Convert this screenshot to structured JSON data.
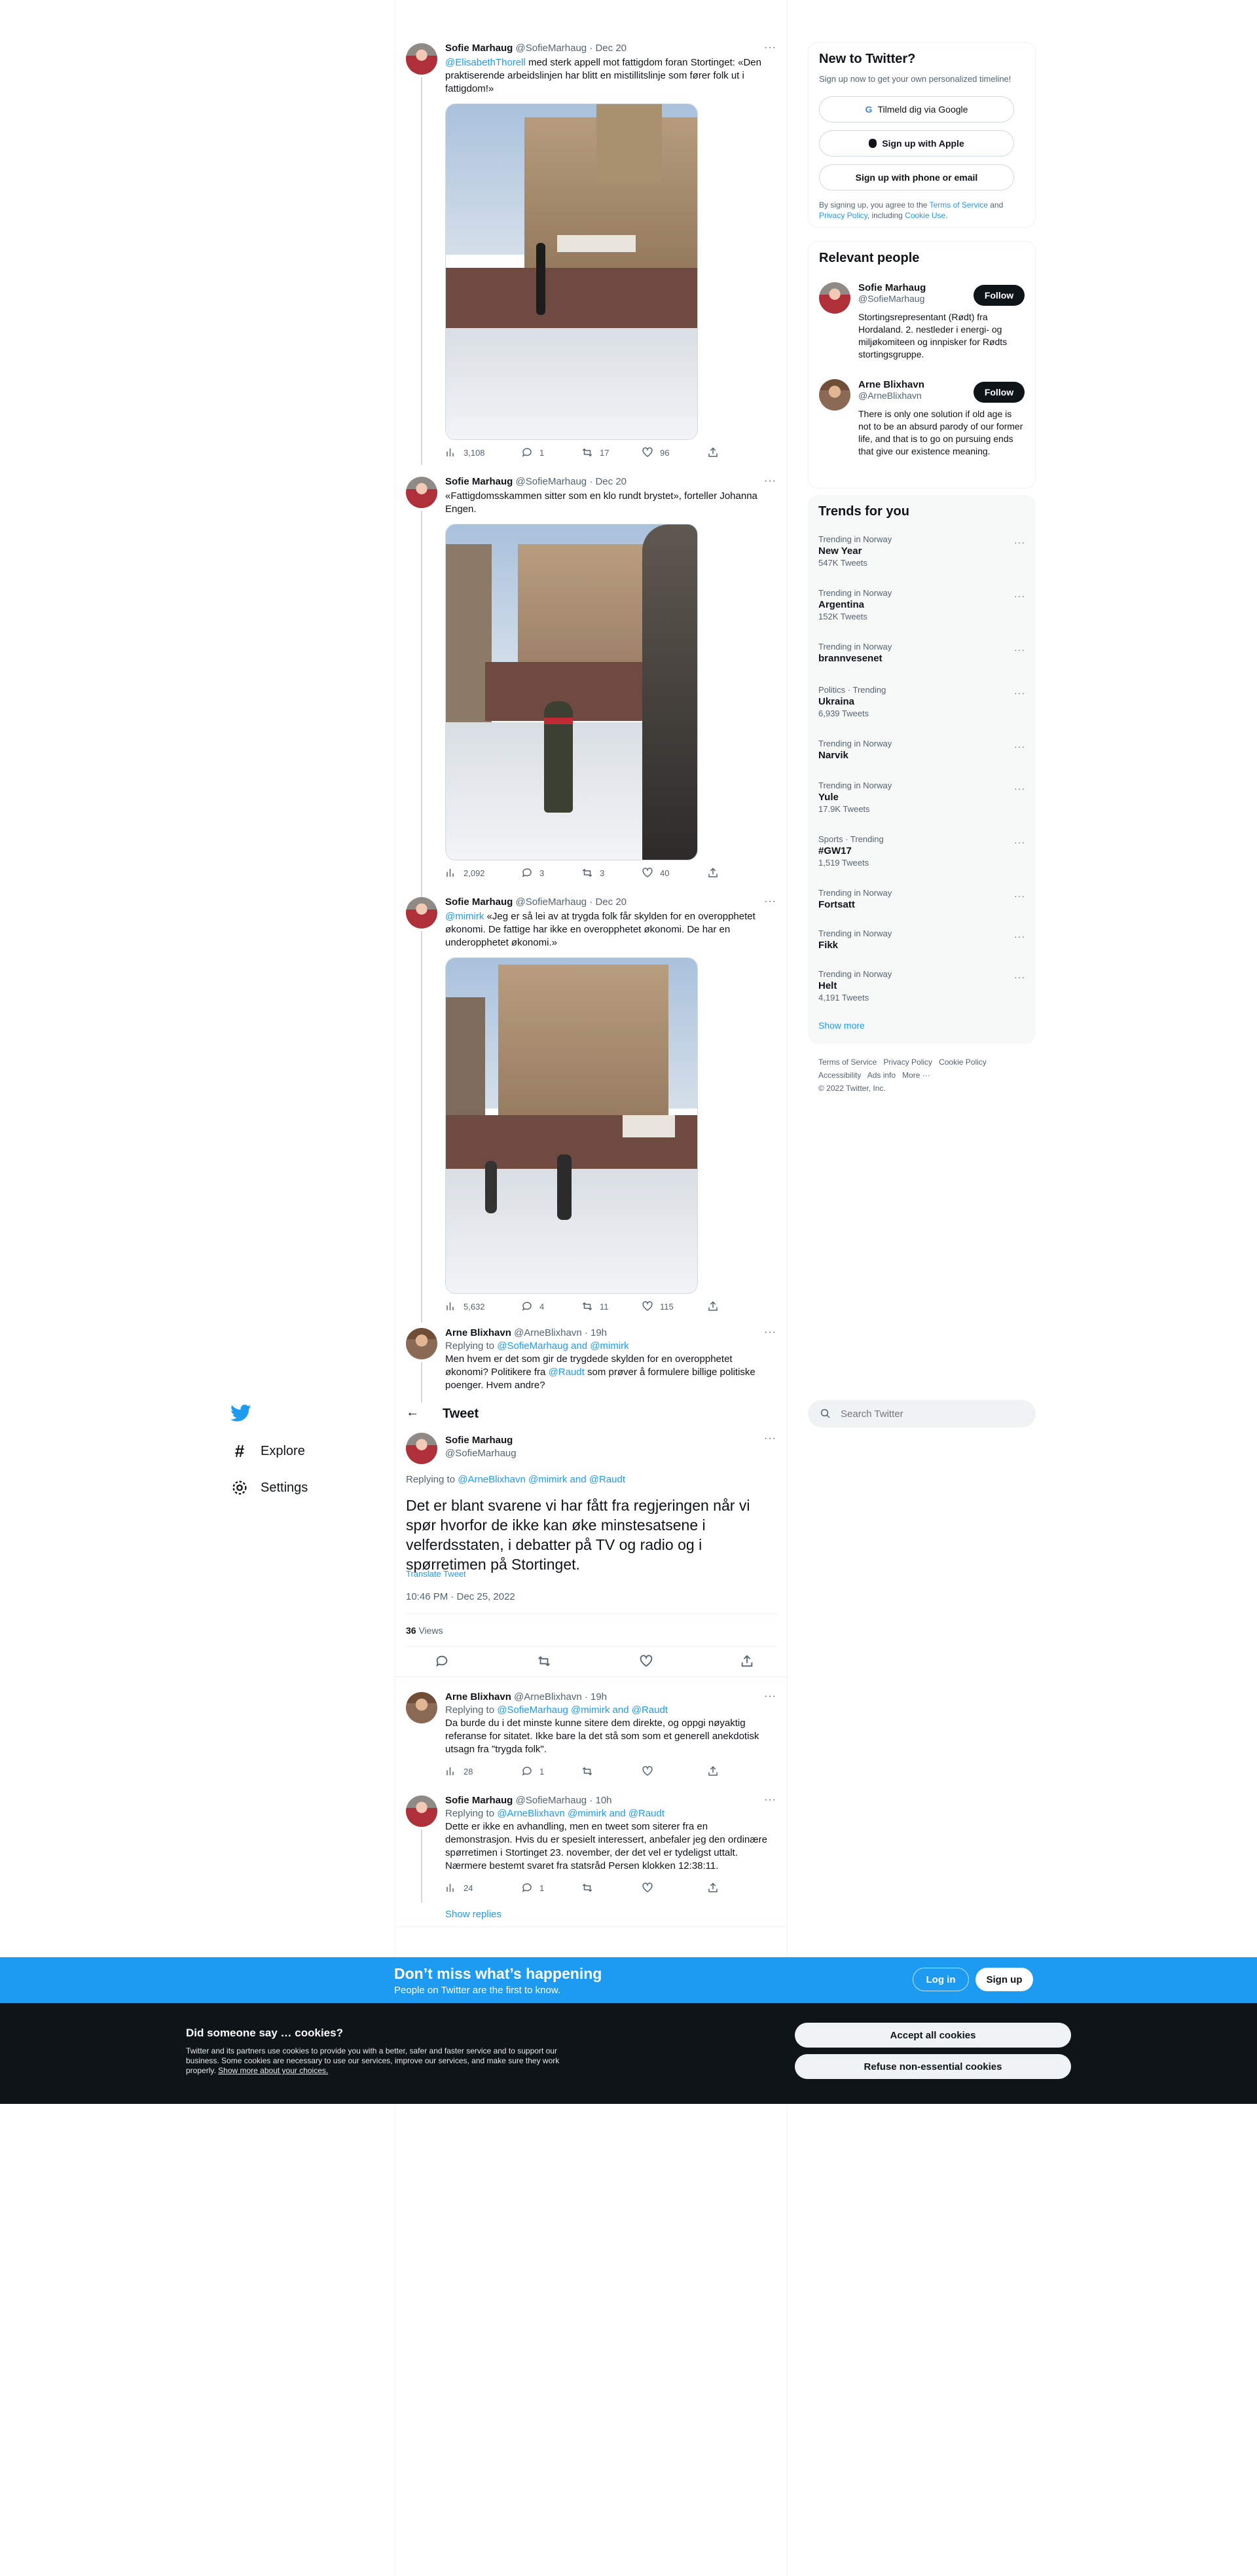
{
  "nav": {
    "explore": "Explore",
    "settings": "Settings"
  },
  "header": {
    "title": "Tweet"
  },
  "search": {
    "placeholder": "Search Twitter"
  },
  "tweets": [
    {
      "name": "Sofie Marhaug",
      "handle": "@SofieMarhaug · Dec 20",
      "mention": "@ElisabethThorell",
      "text": " med sterk appell mot fattigdom foran Stortinget: «Den praktiserende arbeidslinjen har blitt en mistillitslinje som fører folk ut i fattigdom!»",
      "views": "3,108",
      "replies": "1",
      "retweets": "17",
      "likes": "96"
    },
    {
      "name": "Sofie Marhaug",
      "handle": "@SofieMarhaug · Dec 20",
      "text": "«Fattigdomsskammen sitter som en klo rundt brystet», forteller Johanna Engen.",
      "views": "2,092",
      "replies": "3",
      "retweets": "3",
      "likes": "40"
    },
    {
      "name": "Sofie Marhaug",
      "handle": "@SofieMarhaug · Dec 20",
      "mention": "@mimirk",
      "text": " «Jeg er så lei av at trygda folk får skylden for en overopphetet økonomi. De fattige har ikke en overopphetet økonomi. De har en underopphetet økonomi.»",
      "views": "5,632",
      "replies": "4",
      "retweets": "11",
      "likes": "115"
    },
    {
      "name": "Arne Blixhavn",
      "handle": "@ArneBlixhavn · 19h",
      "replying_prefix": "Replying to ",
      "replying_to": "@SofieMarhaug and @mimirk",
      "text_a": "Men hvem er det som gir de trygdede skylden for en overopphetet økonomi? Politikere fra ",
      "text_mention": "@Raudt",
      "text_b": " som prøver å formulere billige politiske poenger. Hvem andre?"
    }
  ],
  "main_tweet": {
    "name": "Sofie Marhaug",
    "handle": "@SofieMarhaug",
    "replying_prefix": "Replying to ",
    "replying_to": "@ArneBlixhavn @mimirk and @Raudt",
    "text": "Det er blant svarene vi har fått fra regjeringen når vi spør hvorfor de ikke kan øke minstesatsene i velferdsstaten, i debatter på TV og radio og i spørretimen på Stortinget.",
    "translate": "Translate Tweet",
    "timestamp": "10:46 PM · Dec 25, 2022",
    "views_count": "36",
    "views_label": " Views"
  },
  "replies": [
    {
      "name": "Arne Blixhavn",
      "handle": "@ArneBlixhavn · 19h",
      "replying_prefix": "Replying to ",
      "replying_to": "@SofieMarhaug @mimirk and @Raudt",
      "text": "Da burde du i det minste kunne sitere dem direkte, og oppgi nøyaktig referanse for sitatet. Ikke bare la det stå som som et generell anekdotisk utsagn fra \"trygda folk\".",
      "views": "28",
      "replies": "1",
      "retweets": "",
      "likes": ""
    },
    {
      "name": "Sofie Marhaug",
      "handle": "@SofieMarhaug · 10h",
      "replying_prefix": "Replying to ",
      "replying_to": "@ArneBlixhavn @mimirk and @Raudt",
      "text": "Dette er ikke en avhandling, men en tweet som siterer fra en demonstrasjon. Hvis du er spesielt interessert, anbefaler jeg den ordinære spørretimen i Stortinget 23. november, der det vel er tydeligst uttalt. Nærmere bestemt svaret fra statsråd Persen klokken 12:38:11.",
      "views": "24",
      "replies": "1",
      "retweets": "",
      "likes": ""
    }
  ],
  "show_replies": "Show replies",
  "signup": {
    "title": "New to Twitter?",
    "subtitle": "Sign up now to get your own personalized timeline!",
    "google": "Tilmeld dig via Google",
    "apple": "Sign up with Apple",
    "phone": "Sign up with phone or email",
    "terms_a": "By signing up, you agree to the ",
    "terms_link": "Terms of Service",
    "terms_b": " and ",
    "privacy_link": "Privacy Policy",
    "terms_c": ", including ",
    "cookie_link": "Cookie Use",
    "terms_d": "."
  },
  "relevant": {
    "title": "Relevant people",
    "follow": "Follow",
    "people": [
      {
        "name": "Sofie Marhaug",
        "handle": "@SofieMarhaug",
        "bio": "Stortingsrepresentant (Rødt) fra Hordaland. 2. nestleder i energi- og miljøkomiteen og innpisker for Rødts stortingsgruppe."
      },
      {
        "name": "Arne Blixhavn",
        "handle": "@ArneBlixhavn",
        "bio": "There is only one solution if old age is not to be an absurd parody of our former life, and that is to go on pursuing ends that give our existence meaning."
      }
    ]
  },
  "trends": {
    "title": "Trends for you",
    "items": [
      {
        "context": "Trending in Norway",
        "name": "New Year",
        "count": "547K Tweets"
      },
      {
        "context": "Trending in Norway",
        "name": "Argentina",
        "count": "152K Tweets"
      },
      {
        "context": "Trending in Norway",
        "name": "brannvesenet",
        "count": ""
      },
      {
        "context": "Politics · Trending",
        "name": "Ukraina",
        "count": "6,939 Tweets"
      },
      {
        "context": "Trending in Norway",
        "name": "Narvik",
        "count": ""
      },
      {
        "context": "Trending in Norway",
        "name": "Yule",
        "count": "17.9K Tweets"
      },
      {
        "context": "Sports · Trending",
        "name": "#GW17",
        "count": "1,519 Tweets"
      },
      {
        "context": "Trending in Norway",
        "name": "Fortsatt",
        "count": ""
      },
      {
        "context": "Trending in Norway",
        "name": "Fikk",
        "count": ""
      },
      {
        "context": "Trending in Norway",
        "name": "Helt",
        "count": "4,191 Tweets"
      }
    ],
    "show_more": "Show more"
  },
  "footer": {
    "terms": "Terms of Service",
    "privacy": "Privacy Policy",
    "cookie": "Cookie Policy",
    "accessibility": "Accessibility",
    "ads": "Ads info",
    "more": "More ···",
    "copyright": "© 2022 Twitter, Inc."
  },
  "banner": {
    "title": "Don’t miss what’s happening",
    "subtitle": "People on Twitter are the first to know.",
    "login": "Log in",
    "signup": "Sign up"
  },
  "cookie": {
    "title": "Did someone say … cookies?",
    "text": "Twitter and its partners use cookies to provide you with a better, safer and faster service and to support our business. Some cookies are necessary to use our services, improve our services, and make sure they work properly. ",
    "link": "Show more about your choices.",
    "accept": "Accept all cookies",
    "refuse": "Refuse non-essential cookies"
  },
  "colors": {
    "accent": "#1d9bf0",
    "text": "#0f1419",
    "muted": "#536471",
    "border": "#eff3f4"
  }
}
